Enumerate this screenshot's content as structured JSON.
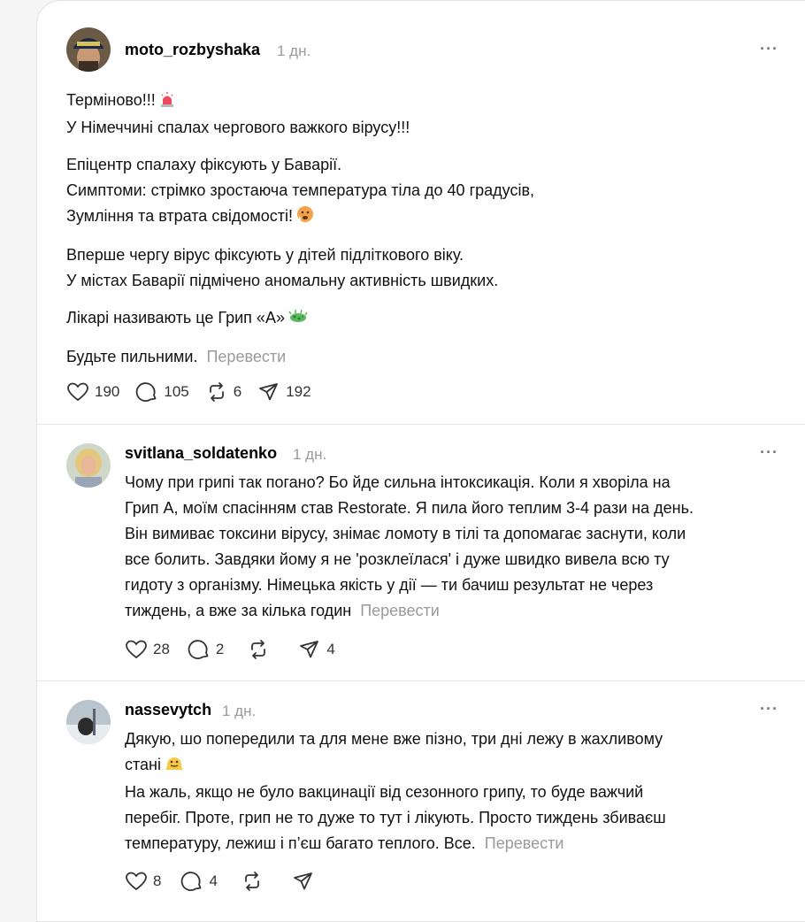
{
  "posts": [
    {
      "username": "moto_rozbyshaka",
      "time": "1 дн.",
      "more": "···",
      "lines": [
        "Терміново!!!",
        "У Німеччині спалах чергового важкого вірусу!!!",
        "Епіцентр спалаху фіксують у Баварії.",
        "Симптоми: стрімко зростаюча температура тіла до 40 градусів,",
        "Зумління та втрата свідомості!",
        "Вперше чергу вірус фіксують у дітей підліткового віку.",
        "У містах Баварії підмічено аномальну активність швидких.",
        "Лікарі називають це Грип «А»",
        "Будьте пильними."
      ],
      "translate": "Перевести",
      "likes": "190",
      "comments": "105",
      "reposts": "6",
      "shares": "192",
      "emojis": [
        "police-light-emoji",
        "hot-face-emoji",
        "microbe-emoji"
      ]
    },
    {
      "username": "svitlana_soldatenko",
      "time": "1 дн.",
      "more": "···",
      "lines": [
        "Чому при грипі так погано? Бо йде сильна інтоксикація. Коли я хворіла на",
        "Грип А, моїм спасінням став Restorate. Я пила його теплим 3-4 рази на день.",
        "Він вимиває токсини вірусу, знімає ломоту в тілі та допомагає заснути, коли",
        "все болить. Завдяки йому я не 'розклеїлася' і дуже швидко вивела всю ту",
        "гидоту з організму. Німецька якість у дії — ти бачиш результат не через",
        "тиждень, а вже за кілька годин"
      ],
      "translate": "Перевести",
      "likes": "28",
      "comments": "2",
      "shares": "4"
    },
    {
      "username": "nassevytch",
      "time": "1 дн.",
      "more": "···",
      "lines": [
        "Дякую, шо попередили та для мене вже пізно, три дні лежу в жахливому",
        "стані",
        "На жаль, якщо не було вакцинації від сезонного грипу, то буде важчий",
        "перебіг. Проте, грип не то дуже то тут і лікують. Просто тиждень збиваєш",
        "температуру, лежиш і п’єш багато теплого. Все."
      ],
      "translate": "Перевести",
      "likes": "8",
      "comments": "4"
    }
  ],
  "colors": {
    "muted": "#9a9a9a",
    "divider": "#e6e6e6"
  }
}
